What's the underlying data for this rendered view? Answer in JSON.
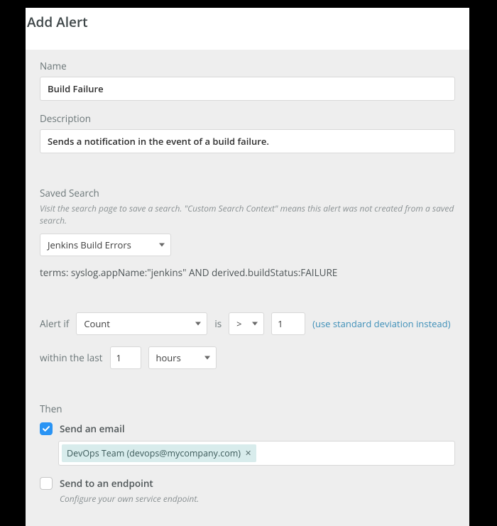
{
  "page_title": "Add Alert",
  "name": {
    "label": "Name",
    "value": "Build Failure"
  },
  "description": {
    "label": "Description",
    "value": "Sends a notification in the event of a build failure."
  },
  "saved_search": {
    "label": "Saved Search",
    "hint": "Visit the search page to save a search. \"Custom Search Context\" means this alert was not created from a saved search.",
    "selected": "Jenkins Build Errors",
    "terms": "terms: syslog.appName:\"jenkins\" AND derived.buildStatus:FAILURE"
  },
  "condition": {
    "prefix": "Alert if",
    "metric": "Count",
    "mid": "is",
    "operator": ">",
    "threshold": "1",
    "std_link": "(use standard deviation instead)",
    "within_prefix": "within the last",
    "within_value": "1",
    "within_unit": "hours"
  },
  "then": {
    "label": "Then",
    "email": {
      "label": "Send an email",
      "checked": true,
      "recipient": "DevOps Team (devops@mycompany.com)"
    },
    "endpoint": {
      "label": "Send to an endpoint",
      "checked": false,
      "hint": "Configure your own service endpoint."
    }
  }
}
